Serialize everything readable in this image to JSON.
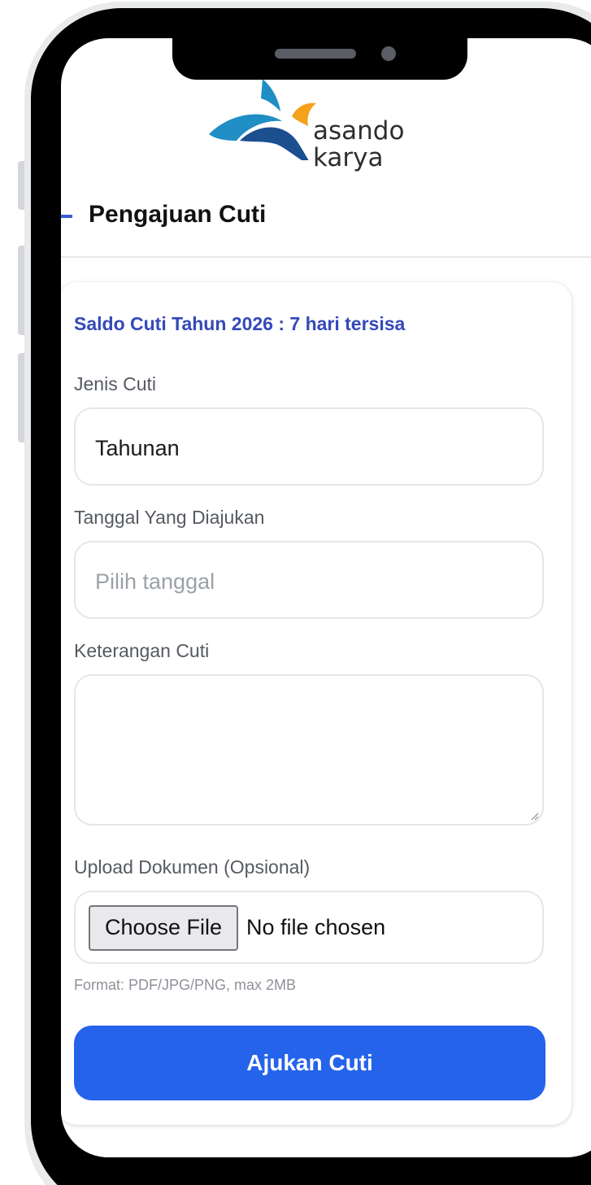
{
  "app": {
    "logo_text_line1": "asando",
    "logo_text_line2": "karya",
    "brand_colors": {
      "blue": "#1f8ec4",
      "navy": "#1b4f8f",
      "orange": "#f4a21c"
    }
  },
  "header": {
    "title": "Pengajuan Cuti",
    "back_icon": "minus-icon"
  },
  "form": {
    "saldo_text": "Saldo Cuti Tahun 2026 : 7 hari tersisa",
    "jenis_cuti": {
      "label": "Jenis Cuti",
      "value": "Tahunan"
    },
    "tanggal": {
      "label": "Tanggal Yang Diajukan",
      "placeholder": "Pilih tanggal"
    },
    "keterangan": {
      "label": "Keterangan Cuti",
      "value": ""
    },
    "upload": {
      "label": "Upload Dokumen (Opsional)",
      "button_label": "Choose File",
      "status": "No file chosen",
      "hint": "Format: PDF/JPG/PNG, max 2MB"
    },
    "submit_label": "Ajukan Cuti"
  },
  "colors": {
    "accent": "#2563eb",
    "saldo_text": "#3449b8",
    "label_text": "#555a61",
    "placeholder_text": "#9ca1a8"
  }
}
